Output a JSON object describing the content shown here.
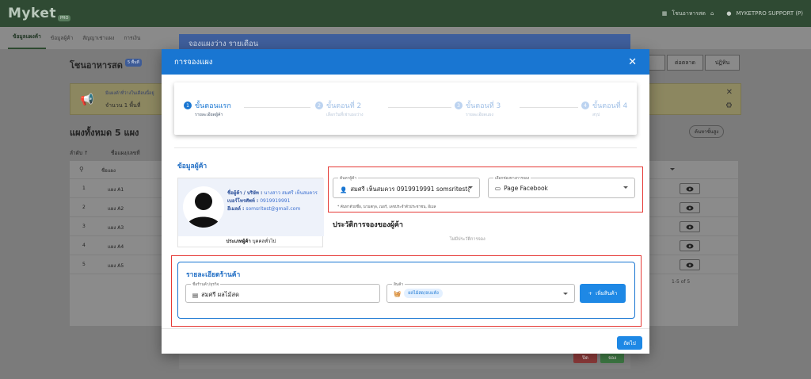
{
  "app": {
    "logo": "Myket",
    "logo_tag": "PRO",
    "market_name": "โชนอาหารสด",
    "user": "MYKETPRO SUPPORT (P)"
  },
  "nav_tabs": [
    "ข้อมูลแผงค้า",
    "ข้อมูลผู้ค้า",
    "สัญญาเช่าแผง",
    "การเงิน"
  ],
  "page": {
    "title": "โชนอาหารสด",
    "badge": "5 พื้นที่",
    "right_buttons": [
      "ต่อตลาด",
      "ปฏิทิน"
    ],
    "banner_line1": "มีแผงค้าที่ว่างในเดือนนี้อยู่",
    "banner_line2": "จำนวน 1 พื้นที่",
    "list_title": "แผงทั้งหมด 5 แผง",
    "sort_label": "ลำดับ ↑",
    "col_header": "ชื่อแผง/เลขที่",
    "filter_label": "ชื่อแผง",
    "search_btn": "ค้นหาขั้นสูง",
    "rows": [
      {
        "num": "1",
        "name": "แผง A1"
      },
      {
        "num": "2",
        "name": "แผง A2"
      },
      {
        "num": "3",
        "name": "แผง A3"
      },
      {
        "num": "4",
        "name": "แผง A4"
      },
      {
        "num": "5",
        "name": "แผง A5"
      }
    ],
    "pager": "1-5 of 5"
  },
  "bg_modal": {
    "title": "จองแผงว่าง รายเดือน",
    "btn_cancel": "ปิด",
    "btn_ok": "จอง"
  },
  "modal": {
    "title": "การจองแผง",
    "steps": [
      {
        "num": "1",
        "title": "ขั้นตอนแรก",
        "sub": "รายละเอียดผู้ค้า"
      },
      {
        "num": "2",
        "title": "ขั้นตอนที่ 2",
        "sub": "เลือกวันที่เช่าแผงว่าง"
      },
      {
        "num": "3",
        "title": "ขั้นตอนที่ 3",
        "sub": "รายละเอียดแผง"
      },
      {
        "num": "4",
        "title": "ขั้นตอนที่ 4",
        "sub": "สรุป"
      }
    ],
    "customer_section_title": "ข้อมูลผู้ค้า",
    "customer": {
      "name_label": "ชื่อผู้ค้า / บริษัท :",
      "name_value": "นางสาว สมศรี เห็นสมควร",
      "phone_label": "เบอร์โทรศัพท์ :",
      "phone_value": "0919919991",
      "email_label": "อีเมลล์ :",
      "email_value": "somsritest@gmail.com",
      "type_label": "ประเภทผู้ค้า",
      "type_value": "บุคคลทั่วไป"
    },
    "search_field": {
      "label": "ค้นหาผู้ค้า",
      "value": "สมศรี เห็นสมควร 0919919991 somsritest@"
    },
    "channel_field": {
      "label": "เลือกช่องทางการจอง",
      "value": "Page Facebook"
    },
    "helper": "* ค้นหาด้วยชื่อ, นามสกุล, เบอร์, เลขประจำตัวประชาชน, อีเมล",
    "history_title": "ประวัติการจองของผู้ค้า",
    "history_empty": "ไม่มีประวัติการจอง",
    "shop_section_title": "รายละเอียดร้านค้า",
    "shop_name_field": {
      "label": "ชื่อร้านค้า/ธุรกิจ",
      "value": "สมศรี ผลไม้สด"
    },
    "product_field": {
      "label": "สินค้า",
      "chip": "ผลไม้สด/อบแห้ง"
    },
    "add_product_btn": "เพิ่มสินค้า",
    "next_btn": "ถัดไป"
  },
  "colors": {
    "primary": "#1976d2",
    "highlight": "#e53935"
  }
}
